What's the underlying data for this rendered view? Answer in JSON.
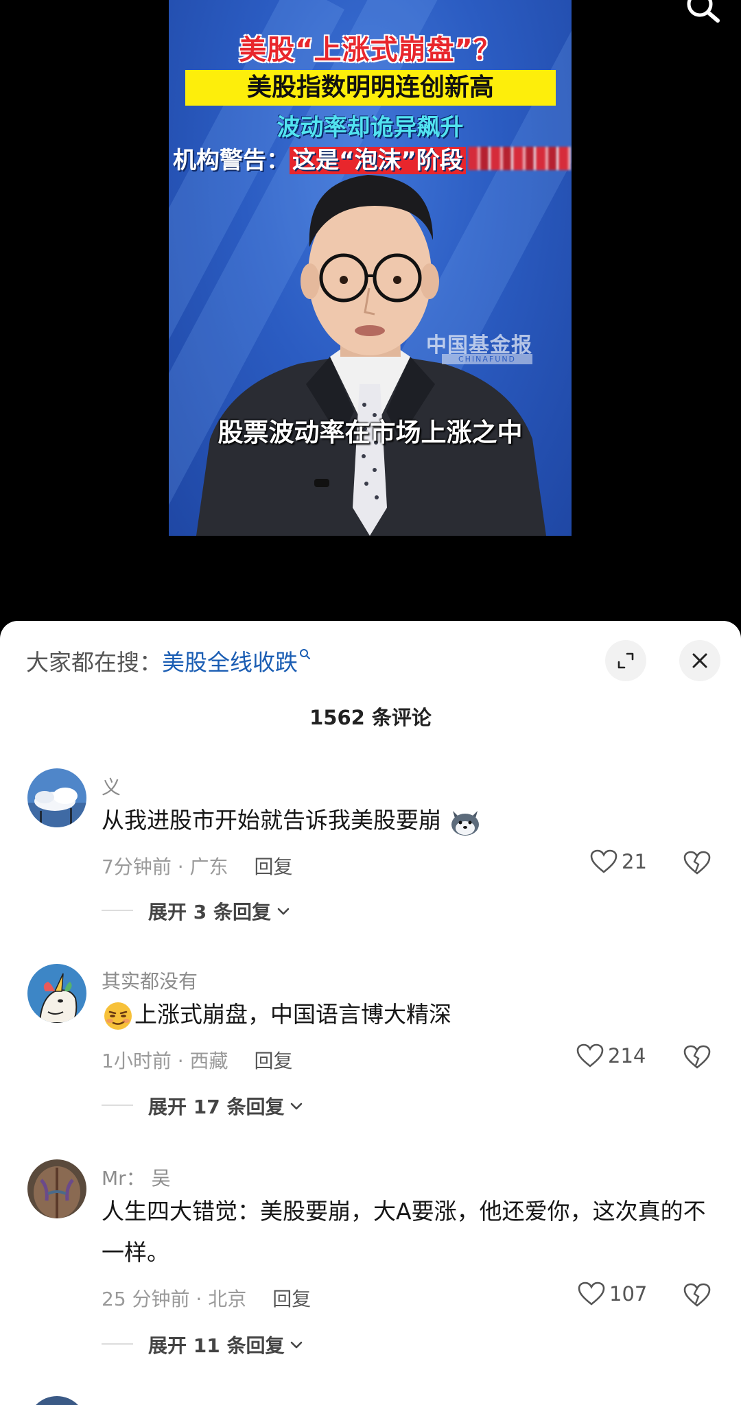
{
  "video": {
    "headline1": "美股“上涨式崩盘”？",
    "headline2": "美股指数明明连创新高",
    "headline3": "波动率却诡异飙升",
    "headline4_prefix": "机构警告：",
    "headline4_highlight": "这是“泡沫”阶段",
    "watermark": "中国基金报",
    "watermark_sub": "CHINAFUND",
    "subtitle": "股票波动率在市场上涨之中",
    "icons": [
      "search-icon"
    ]
  },
  "sheet": {
    "trend_prefix": "大家都在搜：",
    "trend_link": "美股全线收跌",
    "comment_count_title": "1562 条评论",
    "colors": {
      "link": "#1a5db3",
      "meta": "#9a9a9a",
      "text": "#161616"
    }
  },
  "comments": [
    {
      "user": "义",
      "text": "从我进股市开始就告诉我美股要崩",
      "time_location": "7分钟前 · 广东",
      "reply_label": "回复",
      "likes": "21",
      "expand_label": "展开 3 条回复",
      "trailing_emoji": "husky-emoji"
    },
    {
      "user": "其实都没有",
      "text": "上涨式崩盘，中国语言博大精深",
      "time_location": "1小时前 · 西藏",
      "reply_label": "回复",
      "likes": "214",
      "expand_label": "展开 17 条回复",
      "leading_emoji": "smirk-emoji"
    },
    {
      "user": "Mr：  吴",
      "text": "人生四大错觉：美股要崩，大A要涨，他还爱你，这次真的不一样。",
      "time_location": "25 分钟前 · 北京",
      "reply_label": "回复",
      "likes": "107",
      "expand_label": "展开 11 条回复"
    }
  ]
}
